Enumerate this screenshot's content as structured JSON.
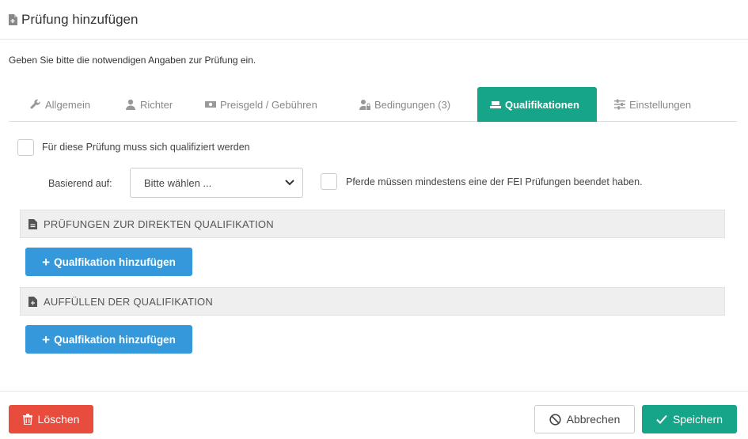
{
  "modal": {
    "title": "Prüfung hinzufügen",
    "intro": "Geben Sie bitte die notwendigen Angaben zur Prüfung ein."
  },
  "tabs": [
    {
      "label": "Allgemein",
      "icon": "wrench-icon"
    },
    {
      "label": "Richter",
      "icon": "user-icon"
    },
    {
      "label": "Preisgeld / Gebühren",
      "icon": "money-icon"
    },
    {
      "label": "Bedingungen (3)",
      "icon": "user-lock-icon"
    },
    {
      "label": "Qualifikationen",
      "icon": "qualification-icon",
      "active": true
    },
    {
      "label": "Einstellungen",
      "icon": "sliders-icon"
    }
  ],
  "qualification": {
    "must_qualify_label": "Für diese Prüfung muss sich qualifiziert werden",
    "based_on_label": "Basierend auf:",
    "based_on_value": "Bitte wählen ...",
    "fei_label": "Pferde müssen mindestens eine der FEI Prüfungen beendet haben."
  },
  "sections": [
    {
      "title": "PRÜFUNGEN ZUR DIREKTEN QUALIFIKATION",
      "button_label": "Qualfikation hinzufügen"
    },
    {
      "title": "AUFFÜLLEN DER QUALIFIKATION",
      "button_label": "Qualfikation hinzufügen"
    }
  ],
  "footer": {
    "delete_label": "Löschen",
    "cancel_label": "Abbrechen",
    "save_label": "Speichern"
  },
  "colors": {
    "primary_teal": "#17a589",
    "button_blue": "#3498db",
    "danger_red": "#e74c3c"
  }
}
